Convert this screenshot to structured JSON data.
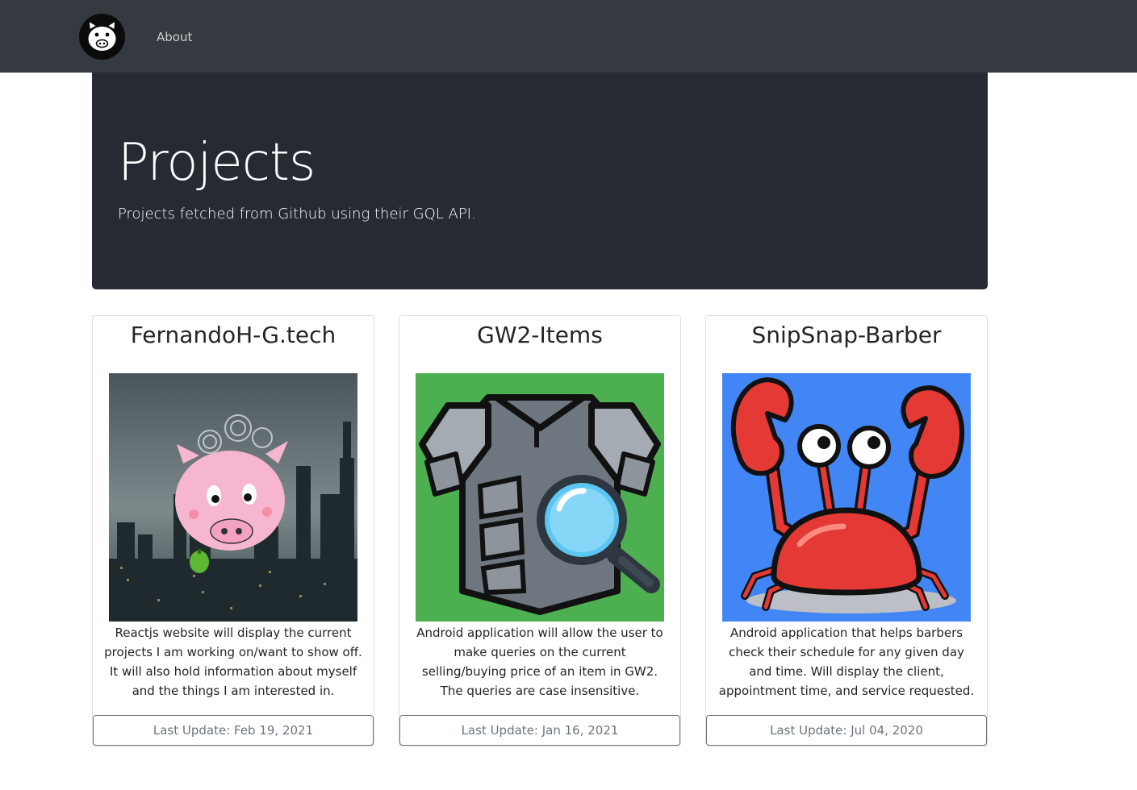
{
  "navbar": {
    "logo_icon": "pig-face-icon",
    "about_label": "About"
  },
  "jumbotron": {
    "title": "Projects",
    "lead": "Projects fetched from Github using their GQL API."
  },
  "projects": [
    {
      "title": "FernandoH-G.tech",
      "image_icon": "pig-over-city-skyline-image",
      "description": "Reactjs website will display the current projects I am working on/want to show off. It will also hold information about myself and the things I am interested in.",
      "last_update": "Last Update: Feb 19, 2021"
    },
    {
      "title": "GW2-Items",
      "image_icon": "armor-with-magnifying-glass-image",
      "description": "Android application will allow the user to make queries on the current selling/buying price of an item in GW2. The queries are case insensitive.",
      "last_update": "Last Update: Jan 16, 2021"
    },
    {
      "title": "SnipSnap-Barber",
      "image_icon": "crab-image",
      "description": "Android application that helps barbers check their schedule for any given day and time. Will display the client, appointment time, and service requested.",
      "last_update": "Last Update: Jul 04, 2020"
    }
  ],
  "colors": {
    "navbar_bg": "#343a40",
    "jumbotron_bg": "#262a32",
    "footer_text": "#6c757d",
    "gw2_bg": "#4caf50",
    "crab_bg": "#4285f4",
    "crab_red": "#e53935",
    "pig_pink": "#f7b6cf"
  }
}
